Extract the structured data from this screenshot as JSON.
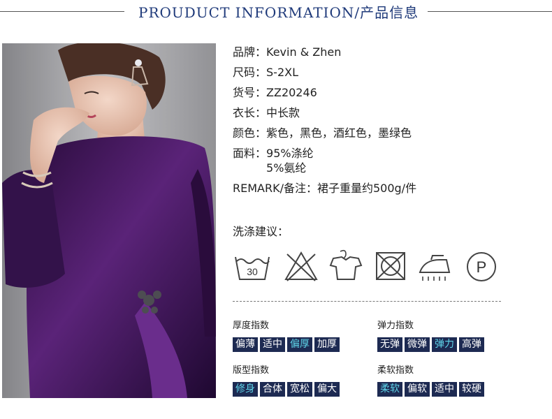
{
  "header": {
    "title": "PROUDUCT INFORMATION/产品信息"
  },
  "product": {
    "brand": {
      "label": "品牌：",
      "value": "Kevin & Zhen"
    },
    "size": {
      "label": "尺码：",
      "value": "S-2XL"
    },
    "item_no": {
      "label": "货号：",
      "value": "ZZ20246"
    },
    "length": {
      "label": "衣长：",
      "value": "中长款"
    },
    "colors": {
      "label": "颜色：",
      "value": "紫色，黑色，酒红色，墨绿色"
    },
    "fabric": {
      "label": "面料：",
      "value": "95%涤纶\n5%氨纶"
    },
    "remark": {
      "label": "REMARK/备注：",
      "value": "裙子重量约500g/件"
    }
  },
  "care": {
    "title": "洗涤建议：",
    "icons": [
      "wash-30-icon",
      "no-bleach-icon",
      "hang-dry-icon",
      "no-tumble-dry-icon",
      "iron-steam-icon",
      "dry-clean-p-icon"
    ],
    "wash_temp": "30",
    "dry_clean_letter": "P"
  },
  "indices": {
    "thickness": {
      "name": "厚度指数",
      "options": [
        "偏薄",
        "适中",
        "偏厚",
        "加厚"
      ],
      "selected": 2
    },
    "elasticity": {
      "name": "弹力指数",
      "options": [
        "无弹",
        "微弹",
        "弹力",
        "高弹"
      ],
      "selected": 2
    },
    "fit": {
      "name": "版型指数",
      "options": [
        "修身",
        "合体",
        "宽松",
        "偏大"
      ],
      "selected": 0
    },
    "softness": {
      "name": "柔软指数",
      "options": [
        "柔软",
        "偏软",
        "适中",
        "较硬"
      ],
      "selected": 0
    }
  },
  "colors": {
    "title": "#1f3a7a",
    "option_bg": "#1d2a52",
    "option_selected_text": "#5fd3e8",
    "dress": "#3b1650"
  }
}
